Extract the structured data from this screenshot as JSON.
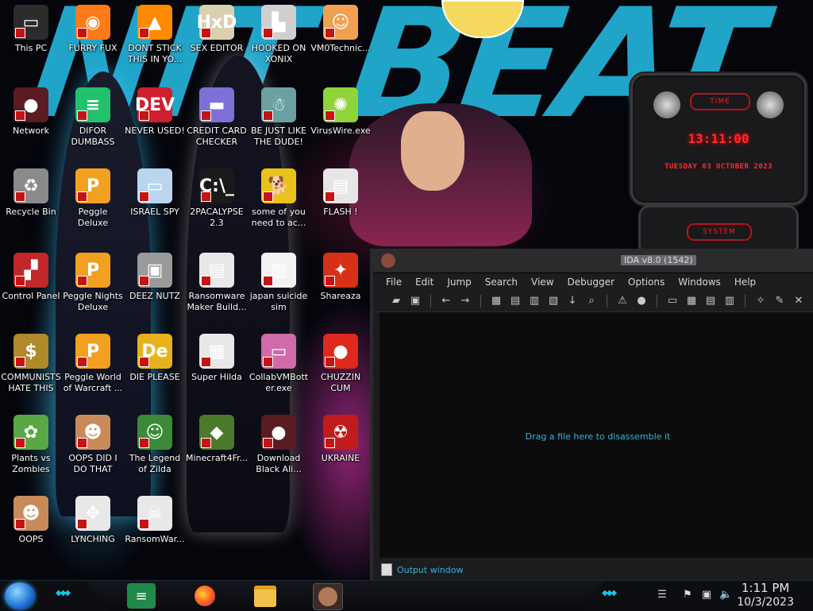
{
  "desktop": {
    "icons": [
      {
        "label": "This PC",
        "glyph": "▭",
        "color": "#2b2b2b"
      },
      {
        "label": "FURRY FUX",
        "glyph": "◉",
        "color": "#ff7a18"
      },
      {
        "label": "DONT STICK THIS IN YO...",
        "glyph": "▲",
        "color": "#ff8a00"
      },
      {
        "label": "SEX EDITOR",
        "glyph": "HxD",
        "color": "#d9d0b0"
      },
      {
        "label": "HOOKED ON XONIX",
        "glyph": "▙",
        "color": "#cfcfcf"
      },
      {
        "label": "VM0Technic...",
        "glyph": "☺",
        "color": "#f0a050"
      },
      {
        "label": "Network",
        "glyph": "●",
        "color": "#5a1b22"
      },
      {
        "label": "DIFOR DUMBASS",
        "glyph": "≡",
        "color": "#23c16b"
      },
      {
        "label": "NEVER USED!",
        "glyph": "DEV",
        "color": "#d01f2e"
      },
      {
        "label": "CREDIT CARD CHECKER",
        "glyph": "▬",
        "color": "#7d71d8"
      },
      {
        "label": "BE JUST LIKE THE DUDE!",
        "glyph": "☃",
        "color": "#6aa0a0"
      },
      {
        "label": "VirusWire.exe",
        "glyph": "✺",
        "color": "#8fd43a"
      },
      {
        "label": "Recycle Bin",
        "glyph": "♻",
        "color": "#8a8a8a"
      },
      {
        "label": "Peggle Deluxe",
        "glyph": "P",
        "color": "#f2a020"
      },
      {
        "label": "ISRAEL SPY",
        "glyph": "▭",
        "color": "#b9d6ee"
      },
      {
        "label": "2PACALYPSE 2.3",
        "glyph": "C:\\_",
        "color": "#1a1a1a"
      },
      {
        "label": "some of you need to ac...",
        "glyph": "🐕",
        "color": "#e9c21c"
      },
      {
        "label": "FLASH !",
        "glyph": "▤",
        "color": "#e6e6e6"
      },
      {
        "label": "Control Panel",
        "glyph": "▞",
        "color": "#c0282c"
      },
      {
        "label": "Peggle Nights Deluxe",
        "glyph": "P",
        "color": "#f2a020"
      },
      {
        "label": "DEEZ NUTZ",
        "glyph": "▣",
        "color": "#9a9a9a"
      },
      {
        "label": "Ransomware Maker Build...",
        "glyph": "▤",
        "color": "#e8e8e8"
      },
      {
        "label": "japan suicide sim",
        "glyph": "▥",
        "color": "#f2f2f2"
      },
      {
        "label": "Shareaza",
        "glyph": "✦",
        "color": "#d83018"
      },
      {
        "label": "COMMUNISTS HATE THIS G...",
        "glyph": "$",
        "color": "#b08a2a"
      },
      {
        "label": "Peggle World of Warcraft ...",
        "glyph": "P",
        "color": "#f2a020"
      },
      {
        "label": "DIE PLEASE",
        "glyph": "De",
        "color": "#e8b21c"
      },
      {
        "label": "Super Hilda",
        "glyph": "▦",
        "color": "#e8e8e8"
      },
      {
        "label": "CollabVMBott er.exe",
        "glyph": "▭",
        "color": "#d06aa8"
      },
      {
        "label": "CHUZZIN CUM",
        "glyph": "●",
        "color": "#e0281c"
      },
      {
        "label": "Plants vs Zombies",
        "glyph": "✿",
        "color": "#5aa845"
      },
      {
        "label": "OOPS DID I DO THAT",
        "glyph": "☻",
        "color": "#c98a5a"
      },
      {
        "label": "The Legend of Zilda",
        "glyph": "☺",
        "color": "#3a8a3a"
      },
      {
        "label": "Minecraft4Fr...",
        "glyph": "◆",
        "color": "#4a7a2a"
      },
      {
        "label": "Download Black Ali...",
        "glyph": "●",
        "color": "#5a1b22"
      },
      {
        "label": "UKRAINE",
        "glyph": "☢",
        "color": "#c01c1c"
      },
      {
        "label": "OOPS",
        "glyph": "☻",
        "color": "#c98a5a"
      },
      {
        "label": "LYNCHING",
        "glyph": "✥",
        "color": "#e8e8e8"
      },
      {
        "label": "RansomWar...",
        "glyph": "☠",
        "color": "#e8e8e8"
      }
    ]
  },
  "clock_widget": {
    "time_label": "TIME",
    "time": "13:11:00",
    "date": "TUESDAY 03 OCTOBER 2023",
    "system_label": "SYSTEM"
  },
  "ida": {
    "title": "IDA v8.0 (1542)",
    "menu": [
      "File",
      "Edit",
      "Jump",
      "Search",
      "View",
      "Debugger",
      "Options",
      "Windows",
      "Help"
    ],
    "hint": "Drag a file here to disassemble it",
    "output_label": "Output window",
    "toolbar_icons": [
      "open-folder-icon",
      "save-icon",
      "back-icon",
      "forward-icon",
      "hex-icon",
      "func-icon",
      "data-icon",
      "code-icon",
      "jump-icon",
      "search-icon",
      "warning-icon",
      "circle-icon",
      "str-icon",
      "array-icon",
      "struct-icon",
      "enum-icon",
      "plugin-icon",
      "edit-icon",
      "close-icon"
    ]
  },
  "taskbar": {
    "time": "1:11 PM",
    "date": "10/3/2023",
    "apps": [
      "discord",
      "firefox",
      "file-explorer",
      "ida"
    ]
  },
  "colors": {
    "accent_cyan": "#18c4e8",
    "clock_red": "#ff2a30",
    "hint_blue": "#34b3d8"
  }
}
